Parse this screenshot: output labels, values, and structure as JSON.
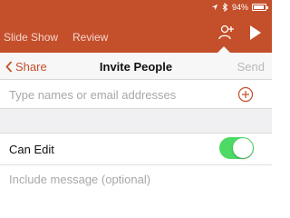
{
  "status_bar": {
    "battery_text": "94%",
    "icons": [
      "location-arrow-icon",
      "bluetooth-icon",
      "battery-icon"
    ],
    "battery_level": 0.94
  },
  "ribbon": {
    "tabs": [
      {
        "label": "Slide Show"
      },
      {
        "label": "Review"
      }
    ],
    "icons": [
      "add-person-icon",
      "play-icon"
    ],
    "background_color": "#c44f2b"
  },
  "invite_sheet": {
    "back_label": "Share",
    "title": "Invite People",
    "send_label": "Send",
    "recipients_placeholder": "Type names or email addresses",
    "can_edit_label": "Can Edit",
    "can_edit_enabled": true,
    "message_placeholder": "Include message (optional)",
    "accent_color": "#c44f2b",
    "toggle_color": "#4cd964"
  }
}
